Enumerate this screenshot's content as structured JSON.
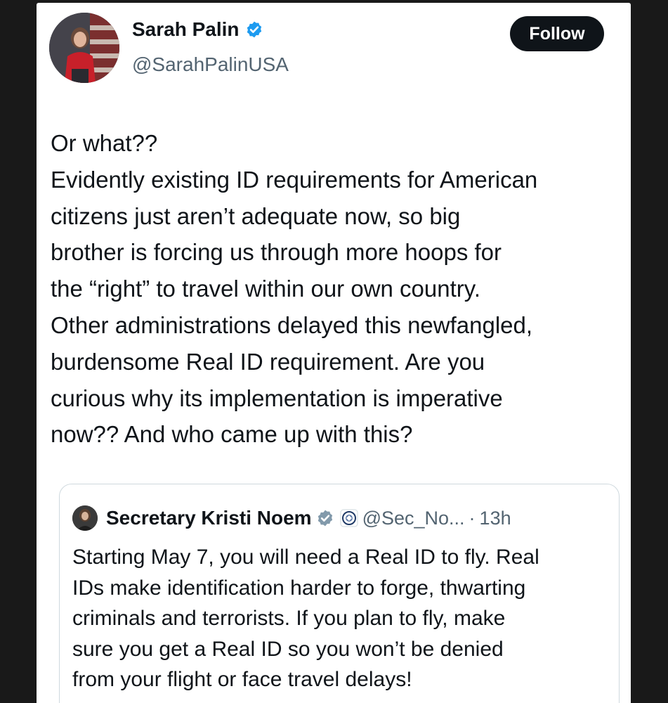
{
  "author": {
    "name": "Sarah Palin",
    "handle": "@SarahPalinUSA",
    "verified_icon": "verified-badge-icon"
  },
  "follow_button": {
    "label": "Follow"
  },
  "tweet": {
    "lines": [
      "Or what??",
      "Evidently existing ID requirements for American",
      "citizens just aren’t adequate now, so big",
      "brother is forcing us through more hoops for",
      "the “right” to travel within our own country.",
      "Other administrations delayed this newfangled,",
      "burdensome Real ID requirement. Are you",
      "curious why its implementation is imperative",
      "now?? And who came up with this?"
    ]
  },
  "quoted_tweet": {
    "name": "Secretary Kristi Noem",
    "handle": "@Sec_No...",
    "separator": "·",
    "time": "13h",
    "verified_icon": "gray-verified-badge-icon",
    "affiliate_icon": "dhs-seal-icon",
    "lines": [
      "Starting May 7, you will need a Real ID to fly. Real",
      "IDs make identification harder to forge, thwarting",
      "criminals and terrorists. If you plan to fly, make",
      "sure you get a Real ID so you won’t be denied",
      "from your flight or face travel delays!"
    ]
  },
  "colors": {
    "text_primary": "#0f1419",
    "text_secondary": "#536471",
    "verified_blue": "#1d9bf0",
    "follow_bg": "#0f1419",
    "border": "#cfd9de"
  }
}
